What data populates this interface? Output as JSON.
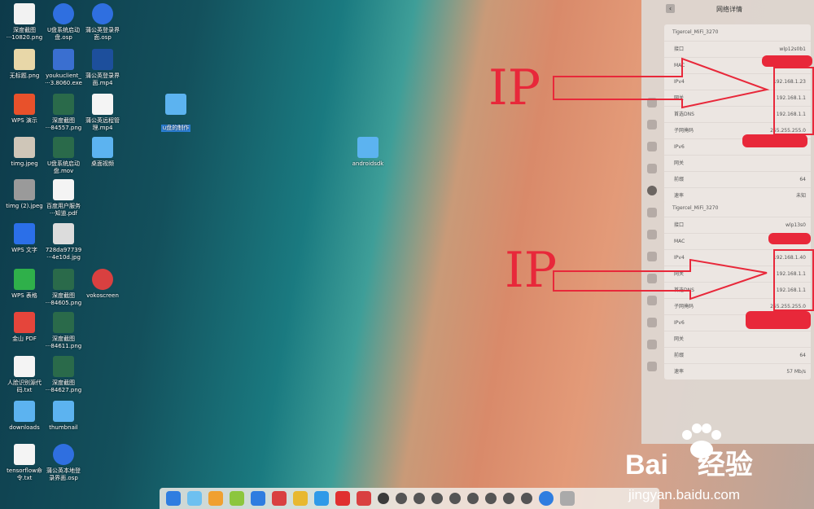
{
  "desktop": {
    "icons": [
      {
        "label": "深度截图\n···10820.png",
        "icon": "screenshot-icon",
        "color": "#f2f2f2"
      },
      {
        "label": "U盘系统启动\n盘.osp",
        "icon": "play-icon",
        "color": "#2f6fe0"
      },
      {
        "label": "蒲公英登录界\n面.osp",
        "icon": "play-icon",
        "color": "#2f6fe0"
      },
      {
        "label": "无标题.png",
        "icon": "image-icon",
        "color": "#e8d7a8"
      },
      {
        "label": "youkuclient_\n···3.8060.exe",
        "icon": "exe-icon",
        "color": "#3a6fd0"
      },
      {
        "label": "蒲公英登录界\n面.mp4",
        "icon": "video-icon",
        "color": "#1d4f9c"
      },
      {
        "label": "WPS 演示",
        "icon": "wps-presentation-icon",
        "color": "#e8512b"
      },
      {
        "label": "深度截图\n···84557.png",
        "icon": "image-icon",
        "color": "#2a6a4a"
      },
      {
        "label": "蒲公英远程管\n理.mp4",
        "icon": "video-icon",
        "color": "#f4f4f4"
      },
      {
        "label": "timg.jpeg",
        "icon": "image-icon",
        "color": "#cfc6b8"
      },
      {
        "label": "U盘系统启动\n盘.mov",
        "icon": "video-icon",
        "color": "#2a6a4a"
      },
      {
        "label": "桌面视频",
        "icon": "folder-icon",
        "color": "#5cb3f0"
      },
      {
        "label": "timg (2).jpeg",
        "icon": "image-icon",
        "color": "#9a9a9a"
      },
      {
        "label": "百度用户服务\n···知道.pdf",
        "icon": "pdf-icon",
        "color": "#f4f4f4"
      },
      {
        "label": "WPS 文字",
        "icon": "wps-writer-icon",
        "color": "#2b6fe8"
      },
      {
        "label": "728da97739\n···4e10d.jpg",
        "icon": "image-icon",
        "color": "#dcdcdc"
      },
      {
        "label": "WPS 表格",
        "icon": "wps-spreadsheet-icon",
        "color": "#2fb04a"
      },
      {
        "label": "深度截图\n···84605.png",
        "icon": "image-icon",
        "color": "#2a6a4a"
      },
      {
        "label": "vokoscreen",
        "icon": "record-icon",
        "color": "#d94040"
      },
      {
        "label": "金山 PDF",
        "icon": "pdf-icon",
        "color": "#e5453b"
      },
      {
        "label": "深度截图\n···84611.png",
        "icon": "image-icon",
        "color": "#2a6a4a"
      },
      {
        "label": "人脸识别源代\n码.txt",
        "icon": "text-file-icon",
        "color": "#f4f4f4"
      },
      {
        "label": "深度截图\n···84627.png",
        "icon": "image-icon",
        "color": "#2a6a4a"
      },
      {
        "label": "downloads",
        "icon": "folder-icon",
        "color": "#5cb3f0"
      },
      {
        "label": "thumbnail",
        "icon": "folder-icon",
        "color": "#5cb3f0"
      },
      {
        "label": "tensorflow命\n令.txt",
        "icon": "text-file-icon",
        "color": "#f4f4f4"
      },
      {
        "label": "蒲公英本地登\n录界面.osp",
        "icon": "play-icon",
        "color": "#2f6fe0"
      },
      {
        "label": "u盘的制作",
        "icon": "folder-icon",
        "color": "#5cb3f0"
      },
      {
        "label": "androidsdk",
        "icon": "folder-icon",
        "color": "#5cb3f0"
      }
    ]
  },
  "network_panel": {
    "title": "网络详情",
    "back_icon": "‹",
    "cards": [
      {
        "ssid": "Tigercel_MiFi_3270",
        "rows": [
          {
            "key": "接口",
            "val": "wlp12s0b1"
          },
          {
            "key": "MAC",
            "val": ""
          },
          {
            "key": "IPv4",
            "val": "192.168.1.23"
          },
          {
            "key": "网关",
            "val": "192.168.1.1"
          },
          {
            "key": "首选DNS",
            "val": "192.168.1.1"
          },
          {
            "key": "子网掩码",
            "val": "255.255.255.0"
          },
          {
            "key": "IPv6",
            "val": ""
          },
          {
            "key": "网关",
            "val": ""
          },
          {
            "key": "前缀",
            "val": "64"
          },
          {
            "key": "速率",
            "val": "未知"
          }
        ]
      },
      {
        "ssid": "Tigercel_MiFi_3270",
        "rows": [
          {
            "key": "接口",
            "val": "wlp13s0"
          },
          {
            "key": "MAC",
            "val": ""
          },
          {
            "key": "IPv4",
            "val": "192.168.1.40"
          },
          {
            "key": "网关",
            "val": "192.168.1.1"
          },
          {
            "key": "首选DNS",
            "val": "192.168.1.1"
          },
          {
            "key": "子网掩码",
            "val": "255.255.255.0"
          },
          {
            "key": "IPv6",
            "val": ""
          },
          {
            "key": "网关",
            "val": ""
          },
          {
            "key": "前缀",
            "val": "64"
          },
          {
            "key": "速率",
            "val": "57 Mb/s"
          }
        ]
      }
    ]
  },
  "annotations": {
    "label_top": "IP",
    "label_bottom": "IP",
    "color": "#e8283a"
  },
  "watermark": {
    "brand": "Bai",
    "brand2": "经验",
    "url": "jingyan.baidu.com"
  },
  "dock": {
    "icons": [
      "launcher-icon",
      "file-manager-icon",
      "app-store-icon",
      "music-icon",
      "video-player-icon",
      "settings-icon",
      "chrome-icon",
      "browser-icon",
      "yandex-icon",
      "record-icon",
      "tray-icon",
      "keyboard-icon",
      "usb-icon",
      "volume-icon",
      "wifi-icon",
      "wifi-icon",
      "pen-icon",
      "screen-icon",
      "collapse-icon",
      "power-icon",
      "trash-icon"
    ]
  }
}
